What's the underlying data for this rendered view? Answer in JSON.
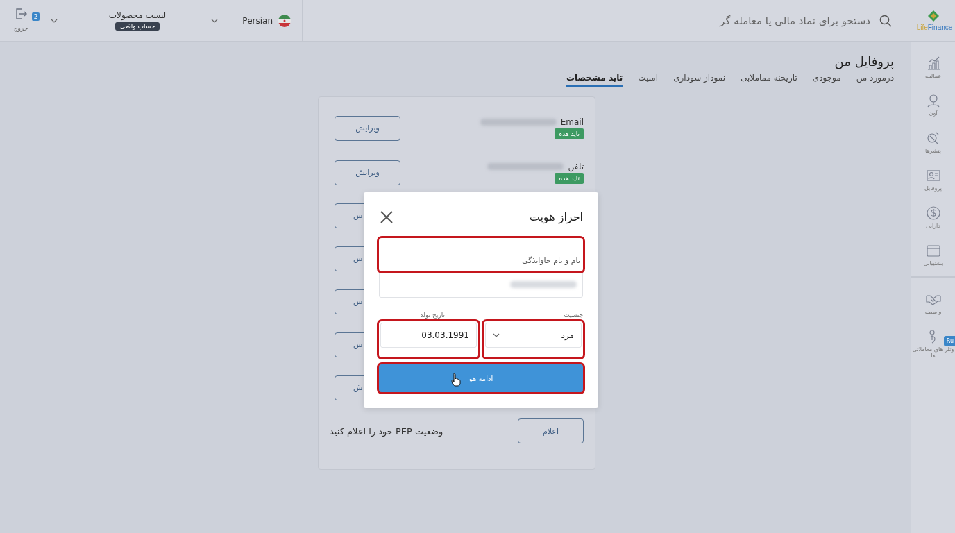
{
  "logo": {
    "part_1": "Life",
    "part_2": "Finance"
  },
  "header": {
    "search": {
      "placeholder": "دستحو برای نماد مالی یا معامله گر"
    },
    "language": {
      "label": "Persian"
    },
    "products": {
      "title": "لیست محصولات",
      "badge": "حساب واقعی"
    },
    "logout": {
      "label": "خروج",
      "badge": "2"
    }
  },
  "sidebar": {
    "items": [
      {
        "label": "عمالمه"
      },
      {
        "label": "آون"
      },
      {
        "label": "پتشرها"
      },
      {
        "label": "پروفایل"
      },
      {
        "label": "دارایی"
      },
      {
        "label": "بشتیبانی"
      },
      {
        "label": "واسطه"
      },
      {
        "label": "وتلر های معاملاتی ها"
      }
    ],
    "badge": "Ru"
  },
  "page": {
    "title": "پروفایل من",
    "tabs": [
      {
        "label": "درمورد من",
        "selected": false
      },
      {
        "label": "موجودی",
        "selected": false
      },
      {
        "label": "تاریحنه مماملابی",
        "selected": false
      },
      {
        "label": "نموداز سوداری",
        "selected": false
      },
      {
        "label": "امنیت",
        "selected": false
      },
      {
        "label": "تاید مشخصات",
        "selected": true
      }
    ]
  },
  "profile_rows": [
    {
      "kind": "contact",
      "label": "Email",
      "status": "تاید هده",
      "button": "ویرایش"
    },
    {
      "kind": "contact",
      "label": "تلفن",
      "status": "تاید هده",
      "button": "ویرایش"
    },
    {
      "kind": "covered",
      "button": "س"
    },
    {
      "kind": "covered",
      "button": "س"
    },
    {
      "kind": "covered",
      "button": "س"
    },
    {
      "kind": "covered",
      "button": "س"
    },
    {
      "kind": "covered",
      "button": "ش"
    },
    {
      "kind": "text",
      "label": "وضعیت PEP حود را اعلام کنید",
      "button": "اعلام"
    }
  ],
  "modal": {
    "title": "احراز هویت",
    "name_field": {
      "placeholder": "نام و نام حاوانذگی",
      "highlighted": true
    },
    "gender": {
      "label": "جنسیت",
      "value": "مرد",
      "highlighted": true
    },
    "birth_date": {
      "label": "تاریخ تولد",
      "value": "03.03.1991",
      "highlighted": true
    },
    "submit": {
      "label": "ادامه هو",
      "highlighted": true
    }
  }
}
